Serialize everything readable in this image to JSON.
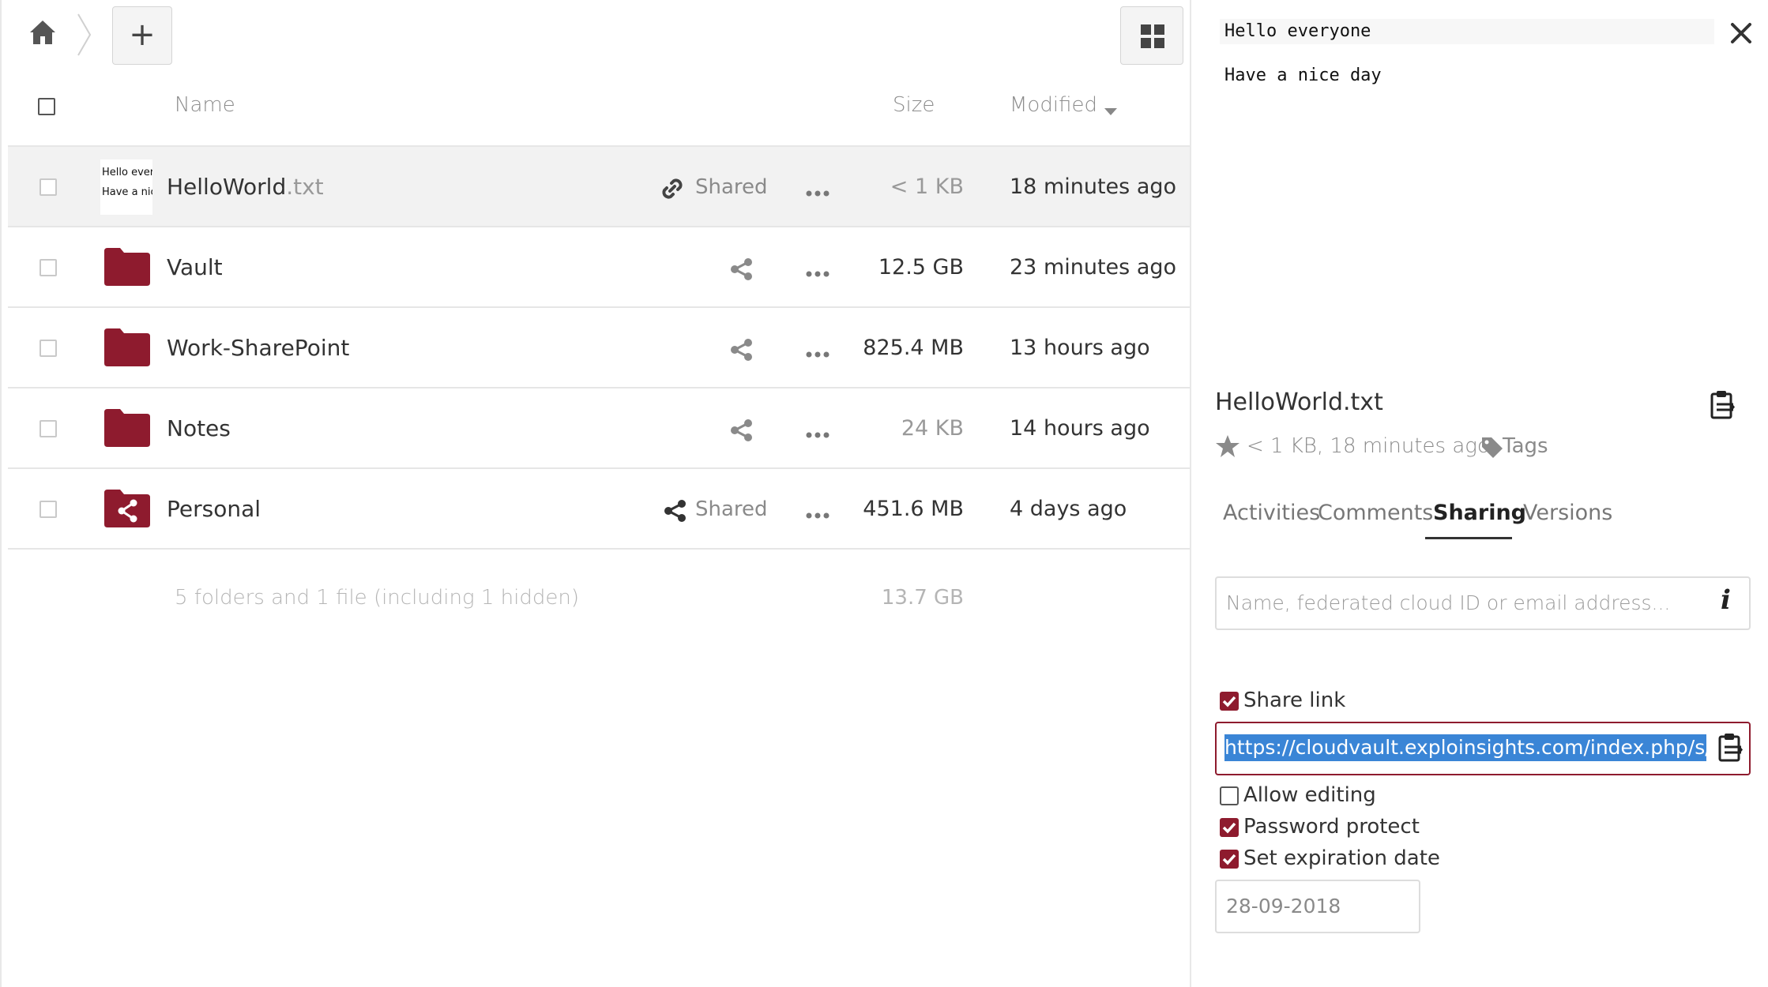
{
  "toolbar": {
    "new_button_label": "+"
  },
  "columns": {
    "name": "Name",
    "size": "Size",
    "modified": "Modified"
  },
  "files": [
    {
      "name": "HelloWorld",
      "ext": ".txt",
      "share": "Shared",
      "size": "< 1 KB",
      "modified": "18 minutes ago",
      "preview_line1": "Hello ever",
      "preview_line2": "Have a nic"
    },
    {
      "name": "Vault",
      "ext": "",
      "share": "",
      "size": "12.5 GB",
      "modified": "23 minutes ago"
    },
    {
      "name": "Work-SharePoint",
      "ext": "",
      "share": "",
      "size": "825.4 MB",
      "modified": "13 hours ago"
    },
    {
      "name": "Notes",
      "ext": "",
      "share": "",
      "size": "24 KB",
      "modified": "14 hours ago"
    },
    {
      "name": "Personal",
      "ext": "",
      "share": "Shared",
      "size": "451.6 MB",
      "modified": "4 days ago"
    }
  ],
  "summary": {
    "text": "5 folders and 1 file (including 1 hidden)",
    "total": "13.7 GB"
  },
  "sidebar": {
    "preview_line1": "Hello everyone",
    "preview_line2": "Have a nice day",
    "filename": "HelloWorld.txt",
    "meta": "< 1 KB, 18 minutes ago",
    "tags_label": "Tags",
    "tabs": [
      "Activities",
      "Comments",
      "Sharing",
      "Versions"
    ],
    "share_input_placeholder": "Name, federated cloud ID or email address...",
    "share_link_label": "Share link",
    "share_link_url": "https://cloudvault.exploinsights.com/index.php/s/ae",
    "allow_editing_label": "Allow editing",
    "password_protect_label": "Password protect",
    "expiration_label": "Set expiration date",
    "expiration_date": "28-09-2018"
  },
  "colors": {
    "accent": "#8e1b2e",
    "selection": "#3a85d6"
  }
}
